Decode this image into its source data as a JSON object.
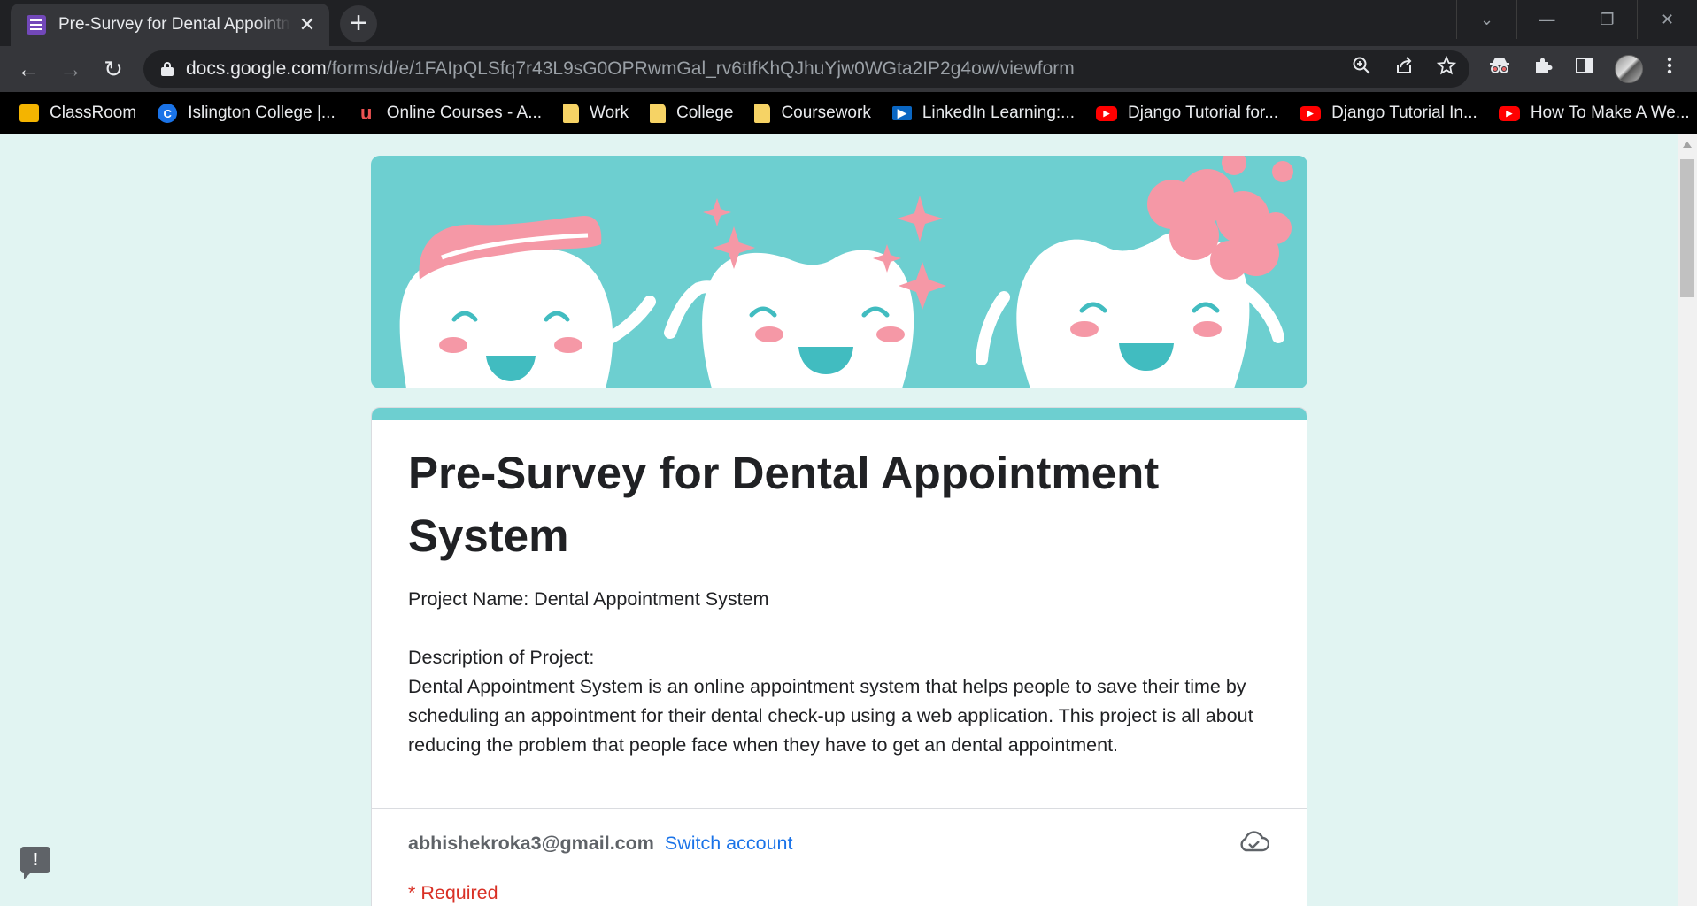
{
  "browser": {
    "tab": {
      "title": "Pre-Survey for Dental Appointment System",
      "close_glyph": "✕"
    },
    "new_tab_glyph": "+",
    "window_controls": {
      "dropdown": "⌄",
      "minimize": "—",
      "restore": "❐",
      "close": "✕"
    },
    "nav": {
      "back": "←",
      "forward": "→",
      "reload": "↻"
    },
    "url": {
      "host": "docs.google.com",
      "path": "/forms/d/e/1FAIpQLSfq7r43L9sG0OPRwmGal_rv6tIfKhQJhuYjw0WGta2IP2g4ow/viewform"
    },
    "toolbar_icons": [
      "zoom-icon",
      "share-icon",
      "bookmark-star-icon",
      "incognito-extension-icon",
      "extensions-puzzle-icon",
      "side-panel-icon",
      "profile-avatar",
      "menu-kebab-icon"
    ],
    "bookmarks": [
      {
        "label": "ClassRoom",
        "icon": "classroom-icon",
        "glyph": ""
      },
      {
        "label": "Islington College |...",
        "icon": "islington-icon",
        "glyph": "C"
      },
      {
        "label": "Online Courses - A...",
        "icon": "udemy-icon",
        "glyph": "u"
      },
      {
        "label": "Work",
        "icon": "folder-icon",
        "glyph": ""
      },
      {
        "label": "College",
        "icon": "folder-icon",
        "glyph": ""
      },
      {
        "label": "Coursework",
        "icon": "folder-icon",
        "glyph": ""
      },
      {
        "label": "LinkedIn Learning:...",
        "icon": "linkedin-icon",
        "glyph": "▶"
      },
      {
        "label": "Django Tutorial for...",
        "icon": "youtube-icon",
        "glyph": "▶"
      },
      {
        "label": "Django Tutorial In...",
        "icon": "youtube-icon",
        "glyph": "▶"
      },
      {
        "label": "How To Make A We...",
        "icon": "youtube-icon",
        "glyph": "▶"
      }
    ]
  },
  "form": {
    "title": "Pre-Survey for Dental Appointment System",
    "description": "Project Name: Dental Appointment System\n\nDescription of Project:\nDental Appointment System is an online appointment system that helps people to save their time by scheduling an appointment for their dental check-up using a web application. This project is all about reducing the problem that people face when they have to get an dental appointment.",
    "account_email": "abhishekroka3@gmail.com",
    "switch_account": "Switch account",
    "required_note": "* Required",
    "feedback_glyph": "!"
  },
  "colors": {
    "theme_teal": "#6dcfd0",
    "page_bg": "#e1f4f2",
    "pink": "#f598a6",
    "link_blue": "#1a73e8",
    "required_red": "#d93025"
  }
}
